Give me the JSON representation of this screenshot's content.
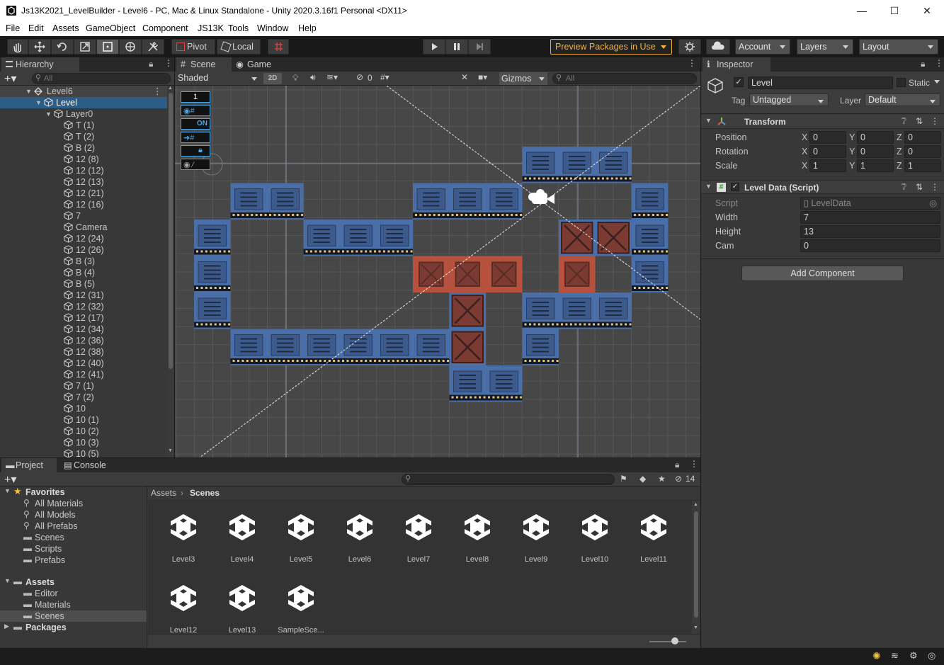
{
  "window": {
    "title": "Js13K2021_LevelBuilder - Level6 - PC, Mac & Linux Standalone - Unity 2020.3.16f1 Personal <DX11>",
    "minimize": "—",
    "maximize": "☐",
    "close": "✕"
  },
  "menu": [
    "File",
    "Edit",
    "Assets",
    "GameObject",
    "Component",
    "JS13K",
    "Tools",
    "Window",
    "Help"
  ],
  "toolbar": {
    "pivot": "Pivot",
    "local": "Local",
    "preview_packages": "Preview Packages in Use",
    "account": "Account",
    "layers": "Layers",
    "layout": "Layout",
    "accent": "#f2b136"
  },
  "hierarchy": {
    "tab": "Hierarchy",
    "search_placeholder": "All",
    "scene": "Level6",
    "selected": "Level",
    "layer": "Layer0",
    "items": [
      "T (1)",
      "T (2)",
      "B (2)",
      "12 (8)",
      "12 (12)",
      "12 (13)",
      "12 (21)",
      "12 (16)",
      "7",
      "Camera",
      "12 (24)",
      "12 (26)",
      "B (3)",
      "B (4)",
      "B (5)",
      "12 (31)",
      "12 (32)",
      "12 (17)",
      "12 (34)",
      "12 (36)",
      "12 (38)",
      "12 (40)",
      "12 (41)",
      "7 (1)",
      "7 (2)",
      "10",
      "10 (1)",
      "10 (2)",
      "10 (3)",
      "10 (5)"
    ]
  },
  "scene": {
    "tab_scene": "Scene",
    "tab_game": "Game",
    "shading": "Shaded",
    "mode_2d": "2D",
    "hidden_count": "0",
    "gizmos": "Gizmos",
    "search_placeholder": "All",
    "overlay": {
      "layer_value": "1",
      "toggle_label": "ON"
    }
  },
  "inspector": {
    "tab": "Inspector",
    "name": "Level",
    "static_label": "Static",
    "tag_label": "Tag",
    "tag_value": "Untagged",
    "layer_label": "Layer",
    "layer_value": "Default",
    "transform": {
      "title": "Transform",
      "rows": [
        {
          "label": "Position",
          "x": "0",
          "y": "0",
          "z": "0"
        },
        {
          "label": "Rotation",
          "x": "0",
          "y": "0",
          "z": "0"
        },
        {
          "label": "Scale",
          "x": "1",
          "y": "1",
          "z": "1"
        }
      ]
    },
    "script_component": {
      "title": "Level Data (Script)",
      "script_label": "Script",
      "script_value": "LevelData",
      "fields": [
        {
          "label": "Width",
          "value": "7"
        },
        {
          "label": "Height",
          "value": "13"
        },
        {
          "label": "Cam",
          "value": "0"
        }
      ]
    },
    "add_component": "Add Component"
  },
  "project": {
    "tab_project": "Project",
    "tab_console": "Console",
    "hidden_count": "14",
    "favorites": "Favorites",
    "favorite_items": [
      "All Materials",
      "All Models",
      "All Prefabs",
      "Scenes",
      "Scripts",
      "Prefabs"
    ],
    "assets": "Assets",
    "asset_folders": [
      "Editor",
      "Materials",
      "Scenes"
    ],
    "packages": "Packages",
    "breadcrumb_root": "Assets",
    "breadcrumb_current": "Scenes",
    "files": [
      "Level3",
      "Level4",
      "Level5",
      "Level6",
      "Level7",
      "Level8",
      "Level9",
      "Level10",
      "Level11",
      "Level12",
      "Level13",
      "SampleSce..."
    ]
  }
}
